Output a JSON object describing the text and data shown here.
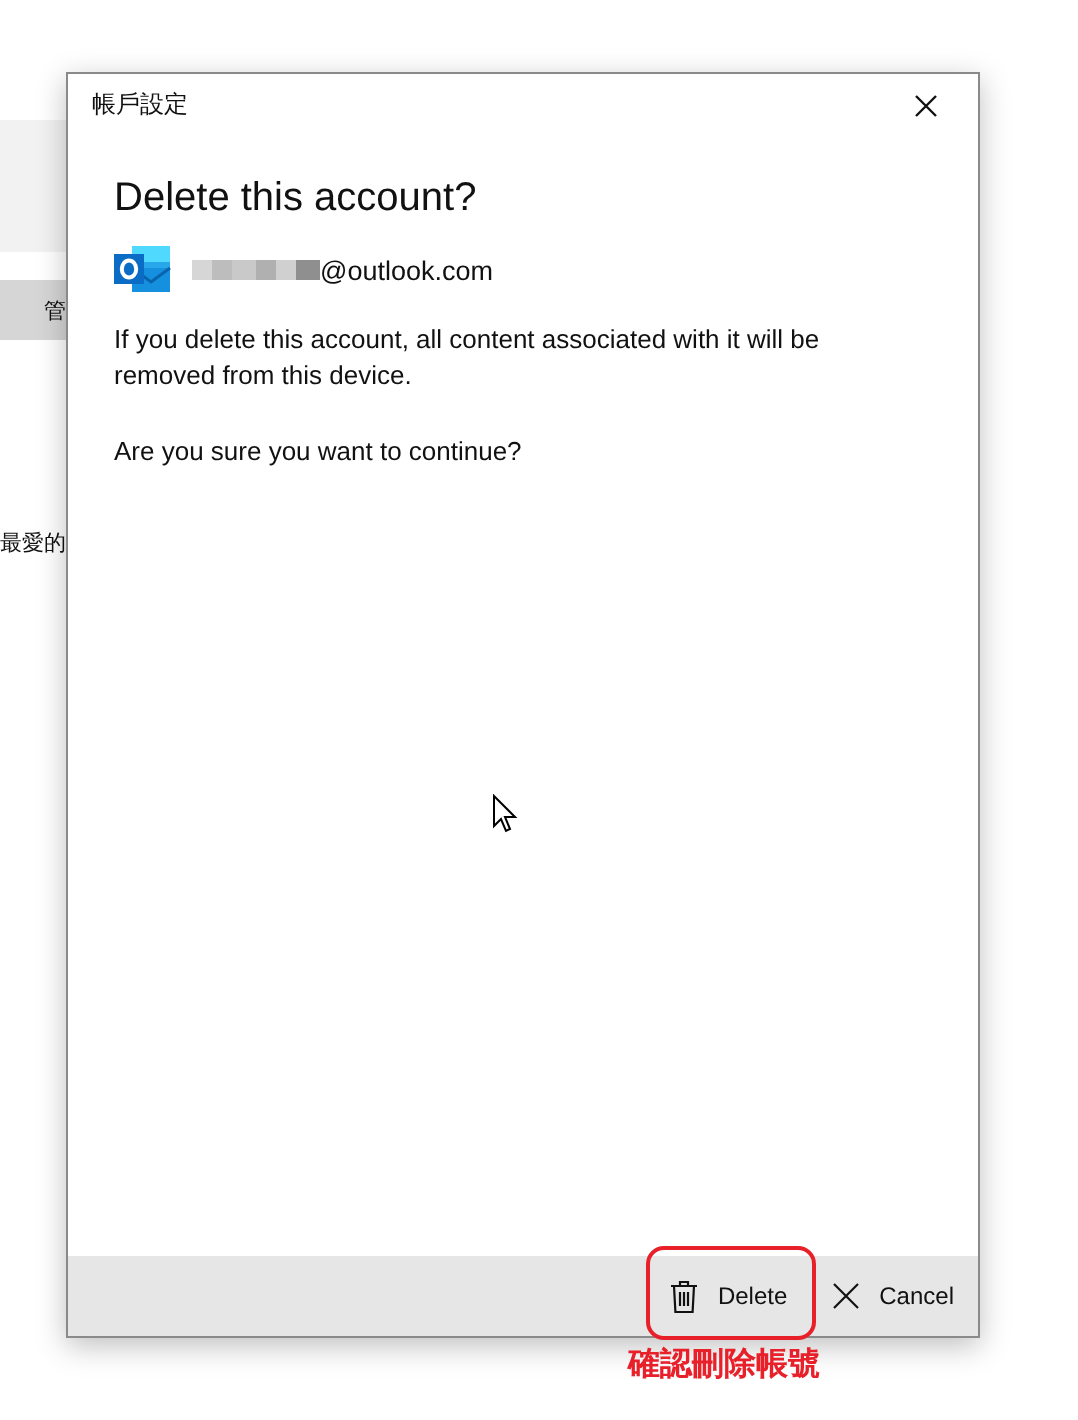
{
  "background": {
    "texts": [
      "管",
      "最愛的"
    ]
  },
  "dialog": {
    "title": "帳戶設定",
    "heading": "Delete this account?",
    "account": {
      "email": "@outlook.com"
    },
    "message": "If you delete this account, all content associated with it will be removed from this device.",
    "question": "Are you sure you want to continue?",
    "buttons": [
      {
        "kind": "delete",
        "label": "Delete"
      },
      {
        "kind": "cancel",
        "label": "Cancel"
      }
    ]
  },
  "annotation": {
    "text": "確認刪除帳號"
  }
}
